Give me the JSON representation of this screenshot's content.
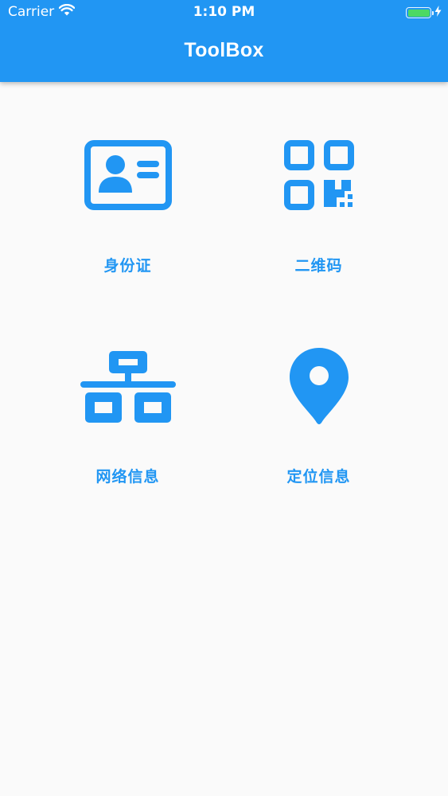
{
  "status_bar": {
    "carrier": "Carrier",
    "time": "1:10 PM",
    "wifi_icon": "wifi-icon",
    "battery_icon": "battery-icon",
    "charging_icon": "charging-bolt-icon"
  },
  "app_bar": {
    "title": "ToolBox"
  },
  "colors": {
    "primary": "#2196f3",
    "background": "#fafafa",
    "battery": "#4cd964"
  },
  "tools": [
    {
      "label": "身份证",
      "icon": "id-card-icon"
    },
    {
      "label": "二维码",
      "icon": "qr-code-icon"
    },
    {
      "label": "网络信息",
      "icon": "network-icon"
    },
    {
      "label": "定位信息",
      "icon": "location-pin-icon"
    }
  ]
}
